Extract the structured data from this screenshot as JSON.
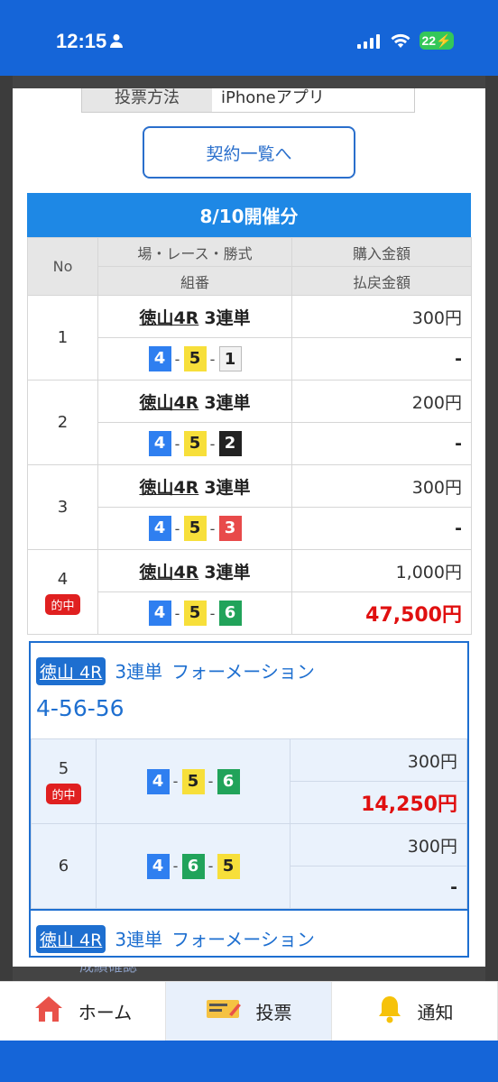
{
  "status_bar": {
    "time": "12:15",
    "battery": "22"
  },
  "method": {
    "label": "投票方法",
    "value": "iPhoneアプリ"
  },
  "contract_button": "契約一覧へ",
  "session": {
    "title": "8/10開催分"
  },
  "table_headers": {
    "no": "No",
    "race_type": "場・レース・勝式",
    "combo": "組番",
    "purchase": "購入金額",
    "payout": "払戻金額"
  },
  "hit_label": "的中",
  "rows": [
    {
      "no": "1",
      "venue": "徳山4R",
      "type": "3連単",
      "combo": [
        "4",
        "5",
        "1"
      ],
      "amount": "300円",
      "payout": "-",
      "hit": false
    },
    {
      "no": "2",
      "venue": "徳山4R",
      "type": "3連単",
      "combo": [
        "4",
        "5",
        "2"
      ],
      "amount": "200円",
      "payout": "-",
      "hit": false
    },
    {
      "no": "3",
      "venue": "徳山4R",
      "type": "3連単",
      "combo": [
        "4",
        "5",
        "3"
      ],
      "amount": "300円",
      "payout": "-",
      "hit": false
    },
    {
      "no": "4",
      "venue": "徳山4R",
      "type": "3連単",
      "combo": [
        "4",
        "5",
        "6"
      ],
      "amount": "1,000円",
      "payout": "47,500円",
      "hit": true
    }
  ],
  "formation1": {
    "race": "徳山 4R",
    "type": "3連単",
    "method": "フォーメーション",
    "pattern": "4-56-56",
    "rows": [
      {
        "no": "5",
        "combo": [
          "4",
          "5",
          "6"
        ],
        "amount": "300円",
        "payout": "14,250円",
        "hit": true
      },
      {
        "no": "6",
        "combo": [
          "4",
          "6",
          "5"
        ],
        "amount": "300円",
        "payout": "-",
        "hit": false
      }
    ]
  },
  "formation2": {
    "race": "徳山 4R",
    "type": "3連単",
    "method": "フォーメーション"
  },
  "behind_text": "成績確認",
  "nav": {
    "home": "ホーム",
    "vote": "投票",
    "notify": "通知"
  },
  "colors": {
    "primary": "#1565d8",
    "session_header": "#1e88e5",
    "hit": "#e02020",
    "payout_red": "#e01010"
  }
}
